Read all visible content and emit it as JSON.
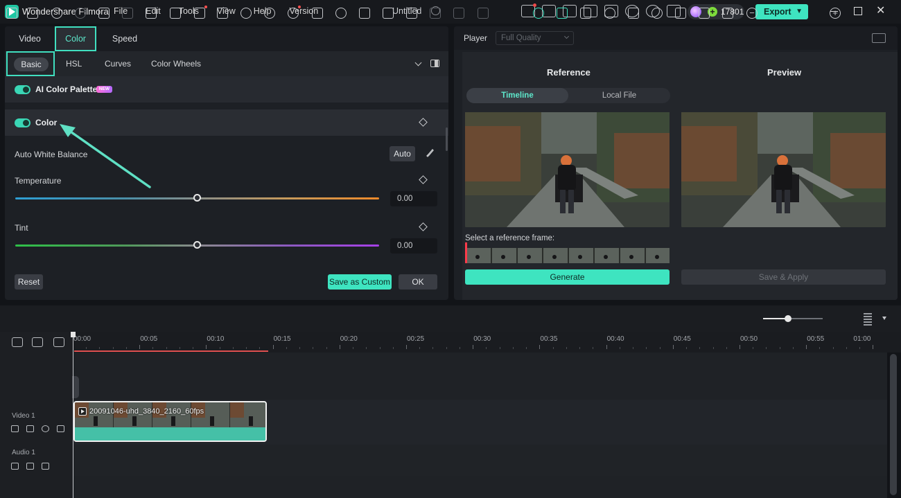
{
  "app": {
    "name": "Wondershare Filmora",
    "doc_title": "Untitled"
  },
  "menu": [
    "File",
    "Edit",
    "Tools",
    "View",
    "Help",
    "Version"
  ],
  "account": {
    "credits": "17801"
  },
  "export": {
    "label": "Export"
  },
  "colors": {
    "accent": "#3ee4c0",
    "highlight_border": "#40e0c0",
    "playhead_red": "#e05050"
  },
  "left_panel": {
    "tabs": [
      "Video",
      "Color",
      "Speed"
    ],
    "active_tab": "Color",
    "subtabs": [
      "Basic",
      "HSL",
      "Curves",
      "Color Wheels"
    ],
    "active_subtab": "Basic",
    "ai_palette": {
      "label": "AI Color Palette",
      "badge": "NEW",
      "enabled": true
    },
    "color_section": {
      "label": "Color",
      "enabled": true
    },
    "auto_wb": {
      "label": "Auto White Balance",
      "button": "Auto"
    },
    "temperature": {
      "label": "Temperature",
      "value": "0.00",
      "position": 0.5
    },
    "tint": {
      "label": "Tint",
      "value": "0.00",
      "position": 0.5
    },
    "buttons": {
      "reset": "Reset",
      "save_custom": "Save as Custom",
      "ok": "OK"
    }
  },
  "right_panel": {
    "player_label": "Player",
    "quality": "Full Quality",
    "reference_title": "Reference",
    "preview_title": "Preview",
    "source_tabs": [
      "Timeline",
      "Local File"
    ],
    "active_source": "Timeline",
    "select_frame_label": "Select a reference frame:",
    "generate": "Generate",
    "save_apply": "Save & Apply"
  },
  "timeline": {
    "ruler": [
      "00:00",
      "00:05",
      "00:10",
      "00:15",
      "00:20",
      "00:25",
      "00:30",
      "00:35",
      "00:40",
      "00:45",
      "00:50",
      "00:55",
      "01:00"
    ],
    "zoom_level": 0.42,
    "tracks": [
      {
        "name": "Video 1"
      },
      {
        "name": "Audio 1"
      }
    ],
    "clip": {
      "title": "20091046-uhd_3840_2160_60fps"
    }
  }
}
